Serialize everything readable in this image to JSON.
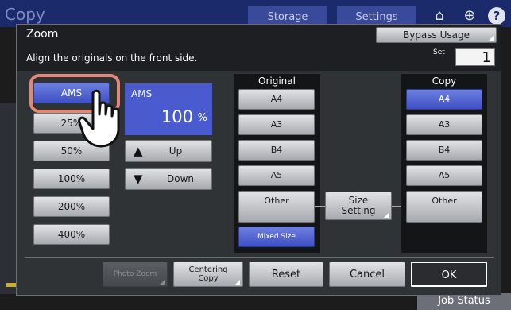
{
  "background": {
    "title": "Copy",
    "tabs": [
      "Storage",
      "Settings"
    ],
    "job_status": "Job Status"
  },
  "dialog": {
    "title": "Zoom",
    "bypass_usage": "Bypass Usage",
    "message": "Align the originals on the front side.",
    "set_label": "Set",
    "set_value": "1",
    "ams_button": "AMS",
    "ams_display": {
      "label": "AMS",
      "value": "100",
      "unit": "%"
    },
    "zoom_presets": [
      "25%",
      "50%",
      "100%",
      "200%",
      "400%"
    ],
    "up_label": "Up",
    "down_label": "Down",
    "original": {
      "header": "Original",
      "sizes": [
        "A4",
        "A3",
        "B4",
        "A5",
        "Other"
      ],
      "mixed_size": "Mixed Size"
    },
    "size_setting": [
      "Size",
      "Setting"
    ],
    "copy": {
      "header": "Copy",
      "sizes": [
        "A4",
        "A3",
        "B4",
        "A5",
        "Other"
      ],
      "selected": "A4"
    },
    "footer": {
      "photo_zoom": "Photo Zoom",
      "centering_copy": [
        "Centering",
        "Copy"
      ],
      "reset": "Reset",
      "cancel": "Cancel",
      "ok": "OK"
    }
  },
  "colors": {
    "selected_blue": "#4a5bd0",
    "highlight_outline": "#e38878",
    "header_blue": "#1a2a6a"
  },
  "icons": [
    "home-icon",
    "globe-icon",
    "help-icon",
    "up-arrow-icon",
    "down-arrow-icon",
    "pointing-hand-icon"
  ]
}
